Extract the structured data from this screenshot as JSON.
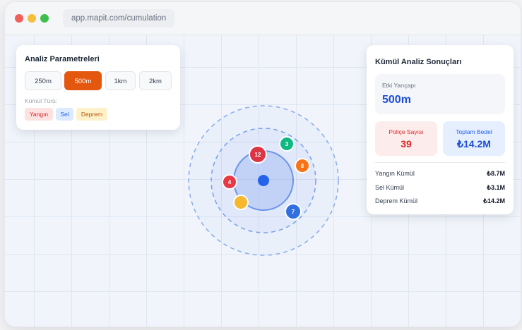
{
  "browser": {
    "url": "app.mapit.com/cumulation",
    "dot_colors": [
      "#f25f58",
      "#f6be3b",
      "#3dc04b"
    ]
  },
  "params_panel": {
    "title": "Analiz Parametreleri",
    "radius_options": [
      {
        "label": "250m",
        "selected": false
      },
      {
        "label": "500m",
        "selected": true
      },
      {
        "label": "1km",
        "selected": false
      },
      {
        "label": "2km",
        "selected": false
      }
    ],
    "type_label": "Kümül Türü:",
    "types": [
      {
        "label": "Yangın",
        "bg": "#fde2e2",
        "fg": "#dc2626"
      },
      {
        "label": "Sel",
        "bg": "#dbeafe",
        "fg": "#2563eb"
      },
      {
        "label": "Deprem",
        "bg": "#fdf1c9",
        "fg": "#b45309"
      }
    ]
  },
  "results_panel": {
    "title": "Kümül Analiz Sonuçları",
    "radius_label": "Etki Yarıçapı",
    "radius_value": "500m",
    "policy_label": "Poliçe Sayısı",
    "policy_value": "39",
    "total_label": "Toplam Bedel",
    "total_value": "₺14.2M",
    "rows": [
      {
        "label": "Yangın Kümül",
        "value": "₺8.7M"
      },
      {
        "label": "Sel Kümül",
        "value": "₺3.1M"
      },
      {
        "label": "Deprem Kümül",
        "value": "₺14.2M"
      }
    ]
  },
  "map": {
    "accent": "#2563eb",
    "markers": [
      {
        "label": "12",
        "color": "#dc3545"
      },
      {
        "label": "3",
        "color": "#10b981"
      },
      {
        "label": "8",
        "color": "#f97316"
      },
      {
        "label": "4",
        "color": "#e63946"
      },
      {
        "label": "",
        "color": "#f5b82e"
      },
      {
        "label": "7",
        "color": "#2f6fe0"
      }
    ]
  }
}
